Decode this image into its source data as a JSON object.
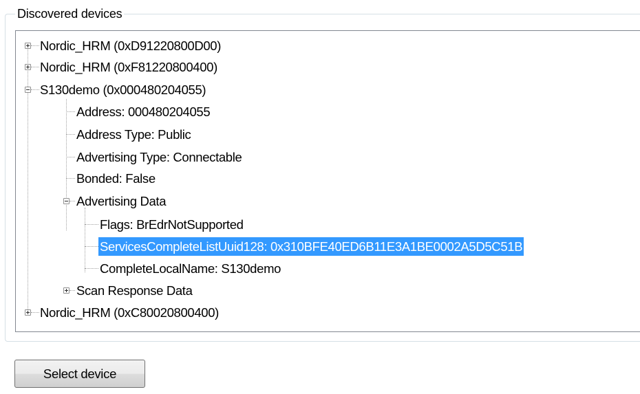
{
  "group_title": "Discovered devices",
  "tree": {
    "nodes": [
      {
        "label": "Nordic_HRM (0xD91220800D00)",
        "expander": "plus"
      },
      {
        "label": "Nordic_HRM (0xF81220800400)",
        "expander": "plus"
      },
      {
        "label": "S130demo (0x000480204055)",
        "expander": "minus"
      },
      {
        "label": "Address: 000480204055"
      },
      {
        "label": "Address Type: Public"
      },
      {
        "label": "Advertising Type: Connectable"
      },
      {
        "label": "Bonded: False"
      },
      {
        "label": "Advertising Data",
        "expander": "minus"
      },
      {
        "label": "Flags: BrEdrNotSupported"
      },
      {
        "label": "ServicesCompleteListUuid128: 0x310BFE40ED6B11E3A1BE0002A5D5C51B",
        "selected": true
      },
      {
        "label": "CompleteLocalName: S130demo"
      },
      {
        "label": "Scan Response Data",
        "expander": "plus"
      },
      {
        "label": "Nordic_HRM (0xC80020800400)",
        "expander": "plus"
      }
    ]
  },
  "select_button_label": "Select device"
}
